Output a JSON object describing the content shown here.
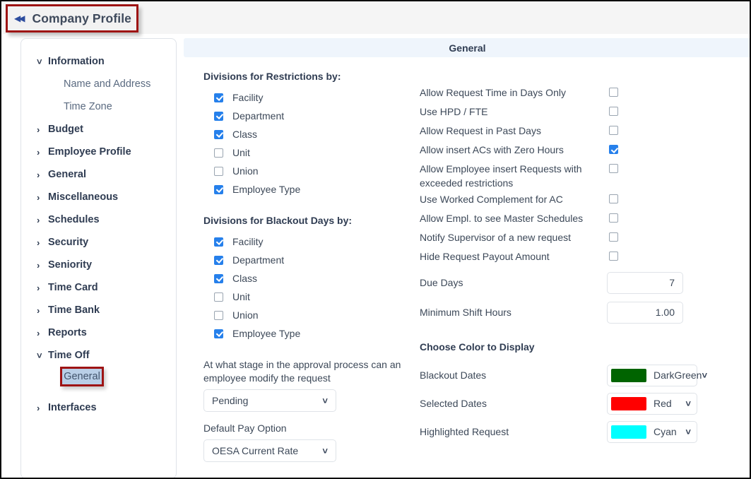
{
  "window": {
    "title": "Company Profile",
    "collapse_icon": "double-left-arrow-icon"
  },
  "sidebar": {
    "items": [
      {
        "label": "Information",
        "type": "group",
        "expanded": true
      },
      {
        "label": "Name and Address",
        "type": "child"
      },
      {
        "label": "Time Zone",
        "type": "child"
      },
      {
        "label": "Budget",
        "type": "group",
        "expanded": false
      },
      {
        "label": "Employee Profile",
        "type": "group",
        "expanded": false
      },
      {
        "label": "General",
        "type": "group",
        "expanded": false
      },
      {
        "label": "Miscellaneous",
        "type": "group",
        "expanded": false
      },
      {
        "label": "Schedules",
        "type": "group",
        "expanded": false
      },
      {
        "label": "Security",
        "type": "group",
        "expanded": false
      },
      {
        "label": "Seniority",
        "type": "group",
        "expanded": false
      },
      {
        "label": "Time Card",
        "type": "group",
        "expanded": false
      },
      {
        "label": "Time Bank",
        "type": "group",
        "expanded": false
      },
      {
        "label": "Reports",
        "type": "group",
        "expanded": false
      },
      {
        "label": "Time Off",
        "type": "group",
        "expanded": true
      },
      {
        "label": "General",
        "type": "child",
        "selected": true
      },
      {
        "label": "Interfaces",
        "type": "group",
        "expanded": false
      }
    ]
  },
  "content": {
    "header": "General",
    "restrictions": {
      "title": "Divisions for Restrictions by:",
      "options": [
        {
          "label": "Facility",
          "checked": true
        },
        {
          "label": "Department",
          "checked": true
        },
        {
          "label": "Class",
          "checked": true
        },
        {
          "label": "Unit",
          "checked": false
        },
        {
          "label": "Union",
          "checked": false
        },
        {
          "label": "Employee Type",
          "checked": true
        }
      ]
    },
    "blackout": {
      "title": "Divisions for Blackout Days by:",
      "options": [
        {
          "label": "Facility",
          "checked": true
        },
        {
          "label": "Department",
          "checked": true
        },
        {
          "label": "Class",
          "checked": true
        },
        {
          "label": "Unit",
          "checked": false
        },
        {
          "label": "Union",
          "checked": false
        },
        {
          "label": "Employee Type",
          "checked": true
        }
      ]
    },
    "approval_stage": {
      "label": "At what stage in the approval process can an employee modify the request",
      "value": "Pending"
    },
    "default_pay_option": {
      "label": "Default Pay Option",
      "value": "OESA Current Rate"
    },
    "toggles": [
      {
        "label": "Allow Request Time in Days Only",
        "checked": false
      },
      {
        "label": "Use HPD / FTE",
        "checked": false
      },
      {
        "label": "Allow Request in Past Days",
        "checked": false
      },
      {
        "label": "Allow insert ACs with Zero Hours",
        "checked": true
      },
      {
        "label": "Allow Employee insert Requests with exceeded restrictions",
        "checked": false
      },
      {
        "label": "Use Worked Complement for AC",
        "checked": false
      },
      {
        "label": "Allow Empl. to see Master Schedules",
        "checked": false
      },
      {
        "label": "Notify Supervisor of a new request",
        "checked": false
      },
      {
        "label": "Hide Request Payout Amount",
        "checked": false
      }
    ],
    "numbers": [
      {
        "label": "Due Days",
        "value": "7"
      },
      {
        "label": "Minimum Shift Hours",
        "value": "1.00"
      }
    ],
    "colors": {
      "title": "Choose Color to Display",
      "rows": [
        {
          "label": "Blackout Dates",
          "value": "DarkGreen",
          "hex": "#006400"
        },
        {
          "label": "Selected Dates",
          "value": "Red",
          "hex": "#FF0000"
        },
        {
          "label": "Highlighted Request",
          "value": "Cyan",
          "hex": "#00FFFF"
        }
      ]
    }
  },
  "theme": {
    "accent": "#2680eb",
    "highlight_border": "#9e1414",
    "selection_bg": "#b9cfe7",
    "header_bg": "#eff5fc"
  }
}
